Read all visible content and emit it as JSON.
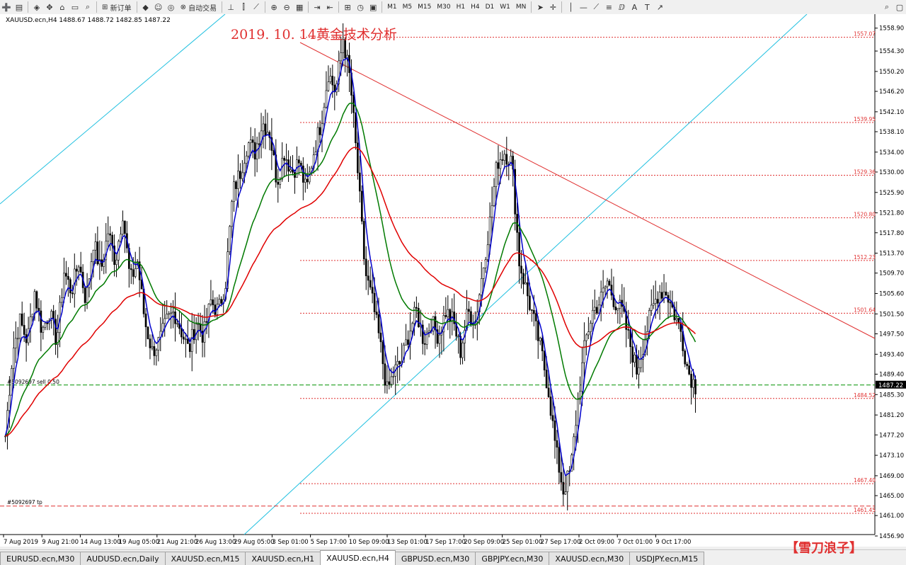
{
  "toolbar": {
    "new_order": "新订单",
    "auto_trading": "自动交易",
    "timeframes": [
      "M1",
      "M5",
      "M15",
      "M30",
      "H1",
      "H4",
      "D1",
      "W1",
      "MN"
    ]
  },
  "chart": {
    "symbol_info": "XAUUSD.ecn,H4  1488.67 1488.72 1482.85 1487.22",
    "annotation_title": "2019. 10. 14黄金技术分析",
    "watermark": "【雪刀浪子】",
    "current_price": "1487.22",
    "order_sell_label": "#5092697 sell 0.50",
    "order_tp_label": "#5092697 tp",
    "colors": {
      "candle": "#000000",
      "ma_fast": "#0000cc",
      "ma_mid": "#007a00",
      "ma_slow": "#e00000",
      "channel": "#20c0e0",
      "level": "#e03030",
      "trendline": "#e03030"
    }
  },
  "chart_data": {
    "type": "candlestick",
    "ylim": [
      1456.9,
      1560.0
    ],
    "price_ticks": [
      "1558.90",
      "1554.30",
      "1550.20",
      "1546.20",
      "1542.10",
      "1538.10",
      "1534.00",
      "1530.00",
      "1525.90",
      "1521.80",
      "1517.80",
      "1513.70",
      "1509.70",
      "1505.60",
      "1501.50",
      "1497.50",
      "1493.40",
      "1489.40",
      "1485.30",
      "1481.20",
      "1477.20",
      "1473.10",
      "1469.00",
      "1465.00",
      "1461.00",
      "1456.90"
    ],
    "time_ticks": [
      "7 Aug 2019",
      "9 Aug 21:00",
      "14 Aug 13:00",
      "19 Aug 05:00",
      "21 Aug 21:00",
      "26 Aug 13:00",
      "29 Aug 05:00",
      "3 Sep 01:00",
      "5 Sep 17:00",
      "10 Sep 09:00",
      "13 Sep 01:00",
      "17 Sep 17:00",
      "20 Sep 09:00",
      "25 Sep 01:00",
      "27 Sep 17:00",
      "2 Oct 09:00",
      "7 Oct 01:00",
      "9 Oct 17:00"
    ],
    "levels": [
      "1557.07",
      "1539.95",
      "1529.36",
      "1520.80",
      "1512.23",
      "1501.64",
      "1484.52",
      "1467.40",
      "1461.45"
    ],
    "close_path": [
      1477,
      1494,
      1500,
      1496,
      1506,
      1498,
      1502,
      1496,
      1510,
      1506,
      1512,
      1504,
      1516,
      1510,
      1518,
      1512,
      1522,
      1508,
      1512,
      1500,
      1494,
      1496,
      1500,
      1502,
      1498,
      1494,
      1500,
      1497,
      1504,
      1502,
      1508,
      1526,
      1530,
      1536,
      1534,
      1540,
      1538,
      1528,
      1534,
      1530,
      1532,
      1526,
      1534,
      1540,
      1550,
      1546,
      1557,
      1548,
      1530,
      1510,
      1504,
      1496,
      1486,
      1490,
      1492,
      1498,
      1502,
      1496,
      1500,
      1497,
      1502,
      1500,
      1494,
      1502,
      1500,
      1510,
      1520,
      1532,
      1534,
      1532,
      1512,
      1506,
      1500,
      1494,
      1486,
      1474,
      1466,
      1470,
      1484,
      1496,
      1502,
      1504,
      1508,
      1504,
      1502,
      1496,
      1490,
      1496,
      1502,
      1506,
      1506,
      1502,
      1498,
      1490,
      1487
    ]
  },
  "tabs": {
    "items": [
      "EURUSD.ecn,M30",
      "AUDUSD.ecn,Daily",
      "XAUUSD.ecn,M15",
      "XAUUSD.ecn,H1",
      "XAUUSD.ecn,H4",
      "GBPUSD.ecn,M30",
      "GBPJPY.ecn,M30",
      "XAUUSD.ecn,M30",
      "USDJPY.ecn,M15"
    ],
    "active_index": 4
  }
}
